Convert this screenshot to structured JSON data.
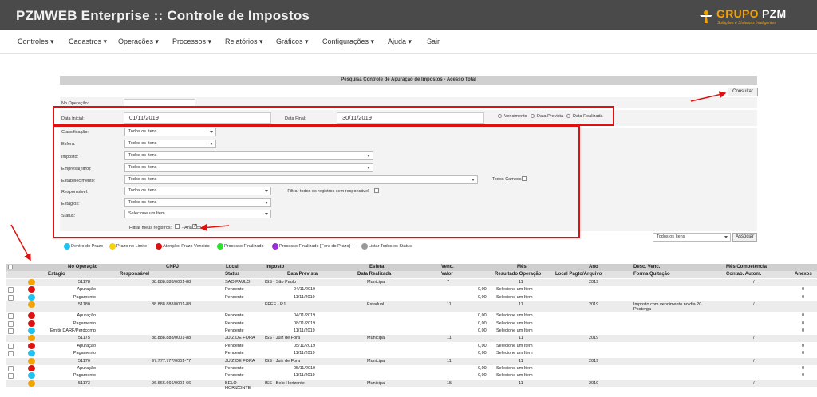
{
  "app": {
    "title": "PZMWEB Enterprise :: Controle de Impostos",
    "logo_main": "GRUPO",
    "logo_brand": "PZM",
    "logo_sub": "Soluções e Sistemas Inteligentes"
  },
  "menu": [
    "Controles",
    "Cadastros",
    "Operações",
    "Processos",
    "Relatórios",
    "Gráficos",
    "Configurações",
    "Ajuda",
    "Sair"
  ],
  "panel": {
    "title": "Pesquisa Controle de Apuração de Impostos - Acesso Total",
    "consultar": "Consultar",
    "no_operacao_label": "No Operação:",
    "data_inicial_label": "Data Inicial:",
    "data_inicial_value": "01/11/2019",
    "data_final_label": "Data Final:",
    "data_final_value": "30/11/2019",
    "radio_vencimento": "Vencimento",
    "radio_data_prevista": "Data Prevista",
    "radio_data_realizada": "Data Realizada",
    "classificacao_label": "Classificação:",
    "esfera_label": "Esfera:",
    "imposto_label": "Imposto:",
    "empresa_label": "Empresa(filtro):",
    "estabelecimento_label": "Estabelecimento:",
    "responsavel_label": "Responsável:",
    "estagios_label": "Estágios:",
    "status_label": "Status:",
    "todos_itens": "Todos os Itens",
    "selecione_item": "Selecione um Item",
    "todos_campos": "Todos Campos",
    "filtrar_resp": "- Filtrar todos os registros sem responsável",
    "filtrar_meus": "Filtrar meus registros:",
    "analitico": "- Analítico",
    "analitico_check": "✔",
    "bottom_select": "Todos os Itens",
    "associar": "Associar"
  },
  "legend": [
    {
      "label": "Dentro do Prazo -",
      "color": "#1fc3f0"
    },
    {
      "label": "Prazo no Limite -",
      "color": "#f5d20a"
    },
    {
      "label": "Atenção: Prazo Vencido -",
      "color": "#e01010"
    },
    {
      "label": "Processo Finalizado -",
      "color": "#2fe02f"
    },
    {
      "label": "Processo Finalizado [Fora do Prazo] -",
      "color": "#9b2fd8"
    },
    {
      "label": "Listar Todos os Status",
      "color": "#999999"
    }
  ],
  "table": {
    "header1": [
      "No Operação",
      "CNPJ",
      "Local",
      "Imposto",
      "Esfera",
      "Venc.",
      "Mês",
      "Ano",
      "Desc. Venc.",
      "Mês Competência"
    ],
    "header2": [
      "Estágio",
      "Responsável",
      "Status",
      "Data Prevista",
      "Data Realizada",
      "Valor",
      "Resultado Operação",
      "Local Pagto/Arquivo",
      "Forma Quitação",
      "Contab. Autom.",
      "Anexos"
    ],
    "rows": [
      {
        "kind": "op",
        "dot": "#f5a300",
        "op": "51178",
        "cnpj": "88.888.888/0001-88",
        "local": "SAO PAULO",
        "imposto": "ISS - São Paulo",
        "esfera": "Municipal",
        "venc": "7",
        "mes": "11",
        "ano": "2019",
        "desc": "",
        "comp": "/"
      },
      {
        "kind": "st",
        "dot": "#e01010",
        "estagio": "Apuração",
        "status": "Pendente",
        "data": "04/11/2019",
        "valor": "0,00",
        "res": "Selecione um Item",
        "anexo": "0"
      },
      {
        "kind": "st",
        "dot": "#1fc3f0",
        "estagio": "Pagamento",
        "status": "Pendente",
        "data": "11/11/2019",
        "valor": "0,00",
        "res": "Selecione um Item",
        "anexo": "0"
      },
      {
        "kind": "op",
        "dot": "#f5a300",
        "op": "51180",
        "cnpj": "88.888.888/0001-88",
        "local": "",
        "imposto": "FEEF - RJ",
        "esfera": "Estadual",
        "venc": "11",
        "mes": "11",
        "ano": "2019",
        "desc": "Imposto com vencimento no dia 20. Posterga",
        "comp": "/"
      },
      {
        "kind": "st",
        "dot": "#e01010",
        "estagio": "Apuração",
        "status": "Pendente",
        "data": "04/11/2019",
        "valor": "0,00",
        "res": "Selecione um Item",
        "anexo": "0"
      },
      {
        "kind": "st",
        "dot": "#e01010",
        "estagio": "Pagamento",
        "status": "Pendente",
        "data": "08/11/2019",
        "valor": "0,00",
        "res": "Selecione um Item",
        "anexo": "0"
      },
      {
        "kind": "st",
        "dot": "#1fc3f0",
        "estagio": "Emitir DARF/Perdcomp",
        "status": "Pendente",
        "data": "11/11/2019",
        "valor": "0,00",
        "res": "Selecione um Item",
        "anexo": "0"
      },
      {
        "kind": "op",
        "dot": "#f5a300",
        "op": "51175",
        "cnpj": "88.888.888/0001-88",
        "local": "JUIZ DE FORA",
        "imposto": "ISS - Juiz de Fora",
        "esfera": "Municipal",
        "venc": "11",
        "mes": "11",
        "ano": "2019",
        "desc": "",
        "comp": "/"
      },
      {
        "kind": "st",
        "dot": "#e01010",
        "estagio": "Apuração",
        "status": "Pendente",
        "data": "05/11/2019",
        "valor": "0,00",
        "res": "Selecione um Item",
        "anexo": "0"
      },
      {
        "kind": "st",
        "dot": "#1fc3f0",
        "estagio": "Pagamento",
        "status": "Pendente",
        "data": "11/11/2019",
        "valor": "0,00",
        "res": "Selecione um Item",
        "anexo": "0"
      },
      {
        "kind": "op",
        "dot": "#f5a300",
        "op": "51176",
        "cnpj": "97.777.777/0001-77",
        "local": "JUIZ DE FORA",
        "imposto": "ISS - Juiz de Fora",
        "esfera": "Municipal",
        "venc": "11",
        "mes": "11",
        "ano": "2019",
        "desc": "",
        "comp": "/"
      },
      {
        "kind": "st",
        "dot": "#e01010",
        "estagio": "Apuração",
        "status": "Pendente",
        "data": "05/11/2019",
        "valor": "0,00",
        "res": "Selecione um Item",
        "anexo": "0"
      },
      {
        "kind": "st",
        "dot": "#1fc3f0",
        "estagio": "Pagamento",
        "status": "Pendente",
        "data": "11/11/2019",
        "valor": "0,00",
        "res": "Selecione um Item",
        "anexo": "0"
      },
      {
        "kind": "op",
        "dot": "#f5a300",
        "op": "51173",
        "cnpj": "96.666.666/0001-66",
        "local": "BELO HORIZONTE",
        "imposto": "ISS - Belo Horizonte",
        "esfera": "Municipal",
        "venc": "15",
        "mes": "11",
        "ano": "2019",
        "desc": "",
        "comp": "/"
      }
    ]
  }
}
